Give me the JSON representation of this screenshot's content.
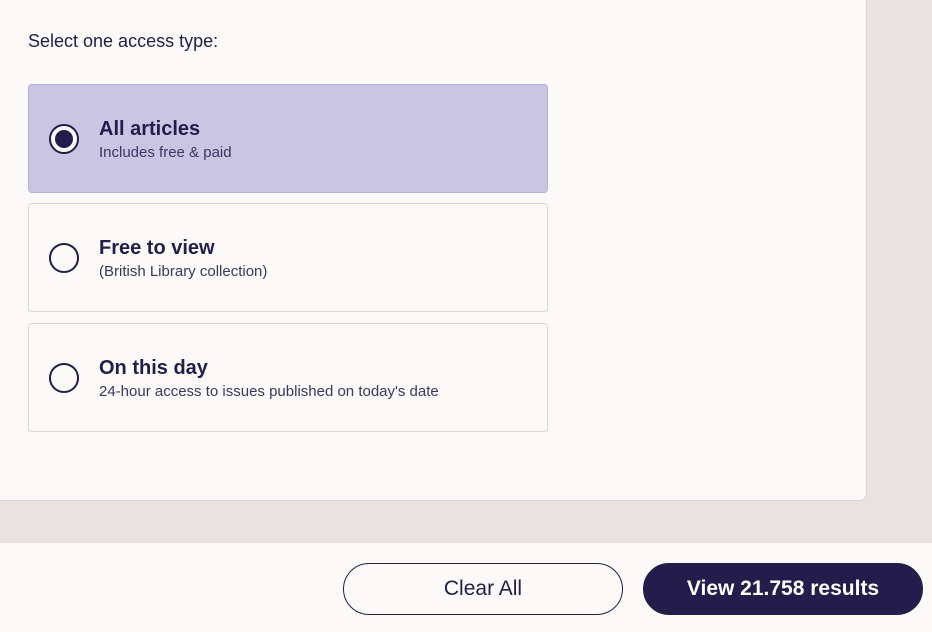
{
  "filter": {
    "prompt": "Select one access type:",
    "options": [
      {
        "title": "All articles",
        "subtitle": "Includes free & paid",
        "selected": true
      },
      {
        "title": "Free to view",
        "subtitle": "(British Library collection)",
        "selected": false
      },
      {
        "title": "On this day",
        "subtitle": "24-hour access to issues published on today's date",
        "selected": false
      }
    ]
  },
  "footer": {
    "clear_label": "Clear All",
    "view_label": "View 21.758 results"
  },
  "colors": {
    "accent": "#241c4a",
    "selected_bg": "#c9c5e3",
    "page_bg": "#e8e3dd"
  }
}
